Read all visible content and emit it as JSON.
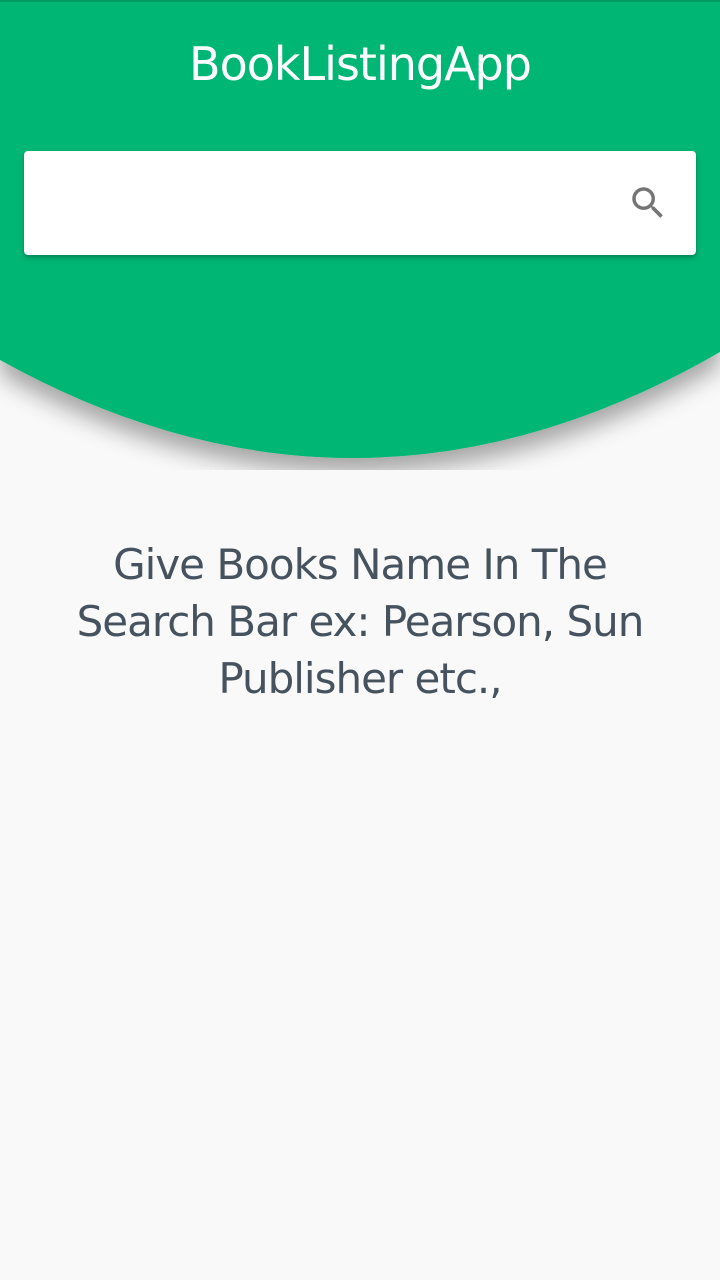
{
  "app": {
    "title": "BookListingApp"
  },
  "search": {
    "value": "",
    "placeholder": "",
    "icon": "search-icon"
  },
  "main": {
    "hint_text": "Give Books Name In The Search Bar ex: Pearson, Sun Publisher etc.,"
  },
  "colors": {
    "header": "#03b674",
    "background": "#f9f9f9",
    "hint_text": "#46535f",
    "icon": "#757575"
  }
}
